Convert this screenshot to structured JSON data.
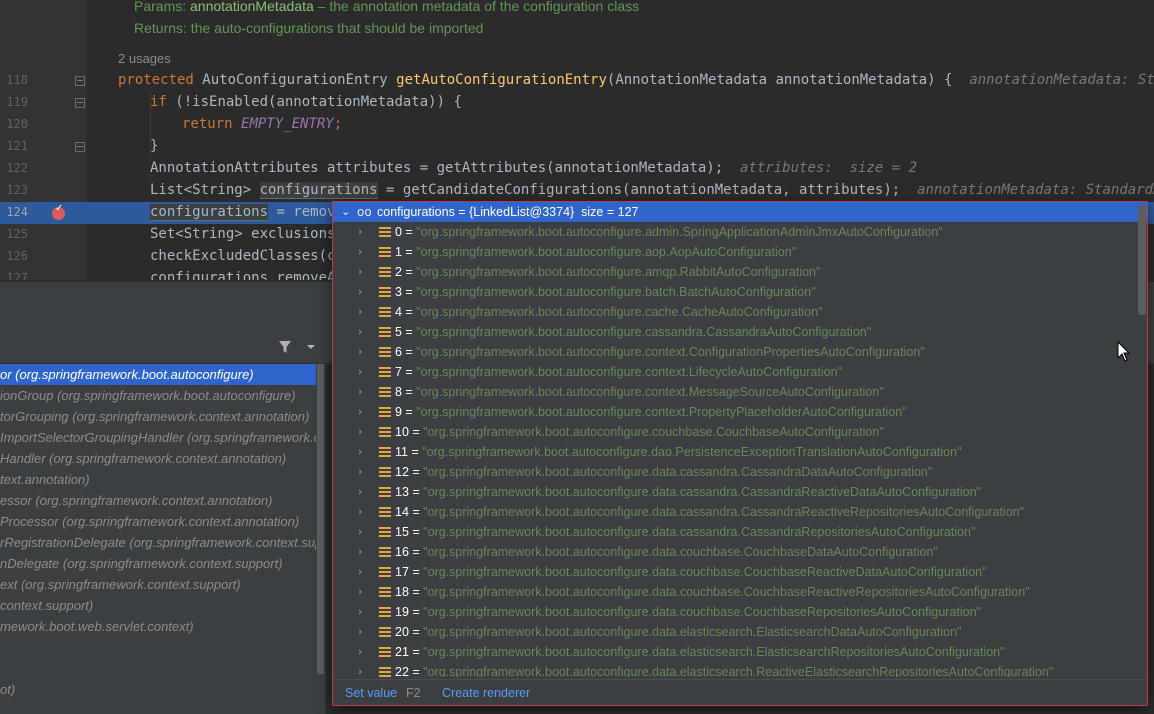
{
  "editor": {
    "doc_params_label": "Params:",
    "doc_params_name": "annotationMetadata",
    "doc_params_text": " – the annotation metadata of the configuration class",
    "doc_returns": "Returns: the auto-configurations that should be imported",
    "usages": "2 usages",
    "lines": [
      {
        "num": "118",
        "kw": "protected ",
        "type": "AutoConfigurationEntry ",
        "fn": "getAutoConfigurationEntry",
        "rest": "(AnnotationMetadata annotationMetadata) {",
        "hint": "annotationMetadata: StandardAnnotat"
      },
      {
        "num": "119",
        "kw": "if ",
        "rest": "(!isEnabled(annotationMetadata)) {"
      },
      {
        "num": "120",
        "kw": "return ",
        "const": "EMPTY_ENTRY",
        "rest": ";"
      },
      {
        "num": "121",
        "rest": "}"
      },
      {
        "num": "122",
        "rest": "AnnotationAttributes attributes = getAttributes(annotationMetadata);",
        "hint": "attributes:  size = 2"
      },
      {
        "num": "123",
        "pre": "List<String> ",
        "var": "configurations",
        "rest": " = getCandidateConfigurations(annotationMetadata, attributes);",
        "hint": "annotationMetadata: StandardAnnota"
      },
      {
        "num": "124",
        "var": "configurations",
        "rest": " = remove"
      },
      {
        "num": "125",
        "rest": "Set<String> exclusions"
      },
      {
        "num": "126",
        "rest": "checkExcludedClasses(co"
      },
      {
        "num": "127",
        "rest": "configurations.removeAl"
      }
    ]
  },
  "frames": [
    {
      "method": "or ",
      "pkg": "(org.springframework.boot.autoconfigure)",
      "selected": true
    },
    {
      "method": "ionGroup ",
      "pkg": "(org.springframework.boot.autoconfigure)"
    },
    {
      "method": "torGrouping ",
      "pkg": "(org.springframework.context.annotation)"
    },
    {
      "method": "ImportSelectorGroupingHandler ",
      "pkg": "(org.springframework.c"
    },
    {
      "method": "Handler ",
      "pkg": "(org.springframework.context.annotation)"
    },
    {
      "method": "",
      "pkg": "text.annotation)"
    },
    {
      "method": "essor ",
      "pkg": "(org.springframework.context.annotation)"
    },
    {
      "method": "Processor ",
      "pkg": "(org.springframework.context.annotation)"
    },
    {
      "method": "rRegistrationDelegate ",
      "pkg": "(org.springframework.context.sup"
    },
    {
      "method": "nDelegate ",
      "pkg": "(org.springframework.context.support)"
    },
    {
      "method": "ext ",
      "pkg": "(org.springframework.context.support)"
    },
    {
      "method": "",
      "pkg": "context.support)"
    },
    {
      "method": "",
      "pkg": "mework.boot.web.servlet.context)"
    },
    {
      "method": "",
      "pkg": ""
    },
    {
      "method": "",
      "pkg": ""
    },
    {
      "method": "",
      "pkg": "ot)"
    }
  ],
  "popup": {
    "header": "configurations = {LinkedList@3374}  size = 127",
    "items": [
      {
        "idx": "0",
        "val": "\"org.springframework.boot.autoconfigure.admin.SpringApplicationAdminJmxAutoConfiguration\""
      },
      {
        "idx": "1",
        "val": "\"org.springframework.boot.autoconfigure.aop.AopAutoConfiguration\""
      },
      {
        "idx": "2",
        "val": "\"org.springframework.boot.autoconfigure.amqp.RabbitAutoConfiguration\""
      },
      {
        "idx": "3",
        "val": "\"org.springframework.boot.autoconfigure.batch.BatchAutoConfiguration\""
      },
      {
        "idx": "4",
        "val": "\"org.springframework.boot.autoconfigure.cache.CacheAutoConfiguration\""
      },
      {
        "idx": "5",
        "val": "\"org.springframework.boot.autoconfigure.cassandra.CassandraAutoConfiguration\""
      },
      {
        "idx": "6",
        "val": "\"org.springframework.boot.autoconfigure.context.ConfigurationPropertiesAutoConfiguration\""
      },
      {
        "idx": "7",
        "val": "\"org.springframework.boot.autoconfigure.context.LifecycleAutoConfiguration\""
      },
      {
        "idx": "8",
        "val": "\"org.springframework.boot.autoconfigure.context.MessageSourceAutoConfiguration\""
      },
      {
        "idx": "9",
        "val": "\"org.springframework.boot.autoconfigure.context.PropertyPlaceholderAutoConfiguration\""
      },
      {
        "idx": "10",
        "val": "\"org.springframework.boot.autoconfigure.couchbase.CouchbaseAutoConfiguration\""
      },
      {
        "idx": "11",
        "val": "\"org.springframework.boot.autoconfigure.dao.PersistenceExceptionTranslationAutoConfiguration\""
      },
      {
        "idx": "12",
        "val": "\"org.springframework.boot.autoconfigure.data.cassandra.CassandraDataAutoConfiguration\""
      },
      {
        "idx": "13",
        "val": "\"org.springframework.boot.autoconfigure.data.cassandra.CassandraReactiveDataAutoConfiguration\""
      },
      {
        "idx": "14",
        "val": "\"org.springframework.boot.autoconfigure.data.cassandra.CassandraReactiveRepositoriesAutoConfiguration\""
      },
      {
        "idx": "15",
        "val": "\"org.springframework.boot.autoconfigure.data.cassandra.CassandraRepositoriesAutoConfiguration\""
      },
      {
        "idx": "16",
        "val": "\"org.springframework.boot.autoconfigure.data.couchbase.CouchbaseDataAutoConfiguration\""
      },
      {
        "idx": "17",
        "val": "\"org.springframework.boot.autoconfigure.data.couchbase.CouchbaseReactiveDataAutoConfiguration\""
      },
      {
        "idx": "18",
        "val": "\"org.springframework.boot.autoconfigure.data.couchbase.CouchbaseReactiveRepositoriesAutoConfiguration\""
      },
      {
        "idx": "19",
        "val": "\"org.springframework.boot.autoconfigure.data.couchbase.CouchbaseRepositoriesAutoConfiguration\""
      },
      {
        "idx": "20",
        "val": "\"org.springframework.boot.autoconfigure.data.elasticsearch.ElasticsearchDataAutoConfiguration\""
      },
      {
        "idx": "21",
        "val": "\"org.springframework.boot.autoconfigure.data.elasticsearch.ElasticsearchRepositoriesAutoConfiguration\""
      },
      {
        "idx": "22",
        "val": "\"org.springframework.boot.autoconfigure.data.elasticsearch.ReactiveElasticsearchRepositoriesAutoConfiguration\""
      }
    ],
    "footer": {
      "set_value": "Set value",
      "set_value_key": "F2",
      "create_renderer": "Create renderer"
    }
  },
  "colors": {
    "selection": "#2f65ca",
    "current_line": "#2d5a9a",
    "string": "#6a8759",
    "keyword": "#cc7832",
    "popup_border": "#c6393b"
  },
  "icons": [
    "fold-marker-icon",
    "breakpoint-icon",
    "filter-icon",
    "dropdown-icon",
    "expand-chevron-icon",
    "field-list-icon",
    "watch-glasses-icon",
    "mouse-cursor-icon"
  ]
}
